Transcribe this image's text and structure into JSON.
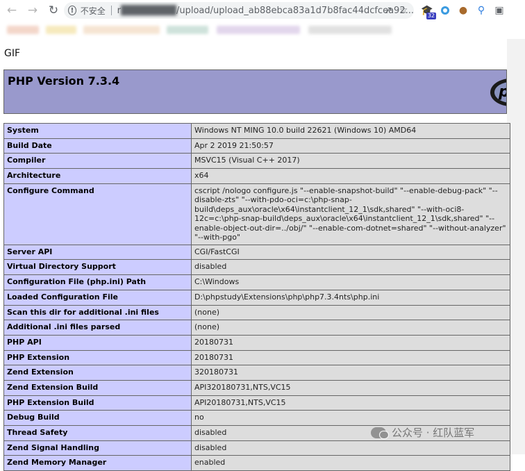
{
  "browser": {
    "address_bar": {
      "insecure_label": "不安全",
      "host_prefix": "r",
      "url_path": "/upload/upload_ab88ebca83a1d7b8fac44dcfcea92..."
    },
    "extensions": {
      "badge": "32"
    }
  },
  "page": {
    "gif_text": "GIF",
    "phpinfo": {
      "title": "PHP Version 7.3.4",
      "logo_text": "php",
      "rows": [
        {
          "key": "System",
          "value": "Windows NT MING 10.0 build 22621 (Windows 10) AMD64"
        },
        {
          "key": "Build Date",
          "value": "Apr 2 2019 21:50:57"
        },
        {
          "key": "Compiler",
          "value": "MSVC15 (Visual C++ 2017)"
        },
        {
          "key": "Architecture",
          "value": "x64"
        },
        {
          "key": "Configure Command",
          "value": "cscript /nologo configure.js \"--enable-snapshot-build\" \"--enable-debug-pack\" \"--disable-zts\" \"--with-pdo-oci=c:\\php-snap-build\\deps_aux\\oracle\\x64\\instantclient_12_1\\sdk,shared\" \"--with-oci8-12c=c:\\php-snap-build\\deps_aux\\oracle\\x64\\instantclient_12_1\\sdk,shared\" \"--enable-object-out-dir=../obj/\" \"--enable-com-dotnet=shared\" \"--without-analyzer\" \"--with-pgo\""
        },
        {
          "key": "Server API",
          "value": "CGI/FastCGI"
        },
        {
          "key": "Virtual Directory Support",
          "value": "disabled"
        },
        {
          "key": "Configuration File (php.ini) Path",
          "value": "C:\\Windows"
        },
        {
          "key": "Loaded Configuration File",
          "value": "D:\\phpstudy\\Extensions\\php\\php7.3.4nts\\php.ini"
        },
        {
          "key": "Scan this dir for additional .ini files",
          "value": "(none)"
        },
        {
          "key": "Additional .ini files parsed",
          "value": "(none)"
        },
        {
          "key": "PHP API",
          "value": "20180731"
        },
        {
          "key": "PHP Extension",
          "value": "20180731"
        },
        {
          "key": "Zend Extension",
          "value": "320180731"
        },
        {
          "key": "Zend Extension Build",
          "value": "API320180731,NTS,VC15"
        },
        {
          "key": "PHP Extension Build",
          "value": "API20180731,NTS,VC15"
        },
        {
          "key": "Debug Build",
          "value": "no"
        },
        {
          "key": "Thread Safety",
          "value": "disabled"
        },
        {
          "key": "Zend Signal Handling",
          "value": "disabled"
        },
        {
          "key": "Zend Memory Manager",
          "value": "enabled"
        }
      ]
    }
  },
  "watermark": {
    "text": "公众号 · 红队蓝军"
  }
}
